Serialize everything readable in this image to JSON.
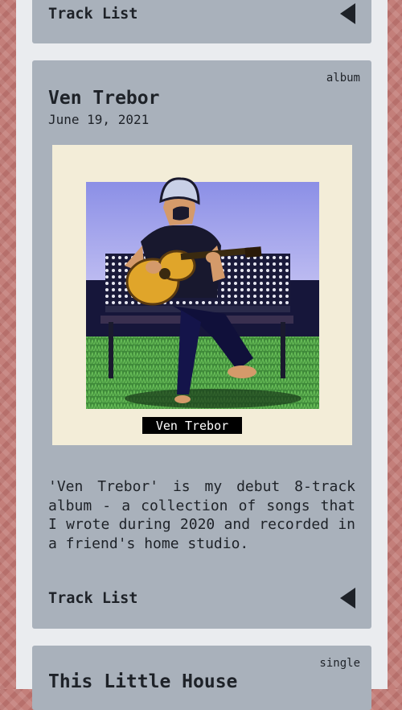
{
  "cards": [
    {
      "track_list_label": "Track List",
      "track_list_icon": "triangle-left-icon"
    },
    {
      "type": "album",
      "title": "Ven Trebor",
      "date": "June 19, 2021",
      "cover_caption": "Ven Trebor",
      "description": "'Ven Trebor' is my debut 8-track album - a collection of songs that I wrote during 2020 and recorded in a friend's home studio.",
      "track_list_label": "Track List",
      "track_list_icon": "triangle-left-icon"
    },
    {
      "type": "single",
      "title": "This Little House"
    }
  ],
  "colors": {
    "page_background": "#c47f7a",
    "column_background": "#eaecef",
    "card_background": "#a9b1bb",
    "cover_mat": "#f3edd8",
    "text": "#1e2228"
  }
}
